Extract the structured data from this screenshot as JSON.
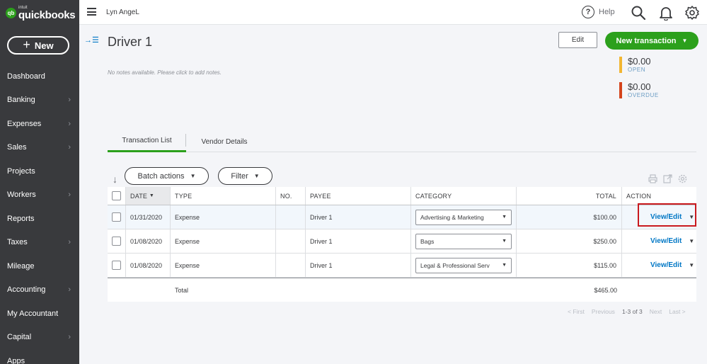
{
  "sidebar": {
    "logo_small": "intuit",
    "logo_name": "quickbooks",
    "logo_mark": "qb",
    "new_label": "New",
    "items": [
      {
        "label": "Dashboard",
        "chevron": false
      },
      {
        "label": "Banking",
        "chevron": true
      },
      {
        "label": "Expenses",
        "chevron": true
      },
      {
        "label": "Sales",
        "chevron": true
      },
      {
        "label": "Projects",
        "chevron": false
      },
      {
        "label": "Workers",
        "chevron": true
      },
      {
        "label": "Reports",
        "chevron": false
      },
      {
        "label": "Taxes",
        "chevron": true
      },
      {
        "label": "Mileage",
        "chevron": false
      },
      {
        "label": "Accounting",
        "chevron": true
      },
      {
        "label": "My Accountant",
        "chevron": false
      },
      {
        "label": "Capital",
        "chevron": true
      },
      {
        "label": "Apps",
        "chevron": false
      }
    ]
  },
  "topbar": {
    "company_name": "Lyn AngeL",
    "help_label": "Help",
    "icons": [
      "help-icon",
      "search-icon",
      "bell-icon",
      "gear-icon"
    ]
  },
  "vendor": {
    "name": "Driver 1",
    "notes_placeholder": "No notes available. Please click to add notes.",
    "edit_label": "Edit",
    "new_transaction_label": "New transaction",
    "open_amount": "$0.00",
    "open_label": "OPEN",
    "overdue_amount": "$0.00",
    "overdue_label": "OVERDUE",
    "open_color": "#f2b632",
    "overdue_color": "#d4441c"
  },
  "tabs": [
    {
      "label": "Transaction List",
      "active": true
    },
    {
      "label": "Vendor Details",
      "active": false
    }
  ],
  "toolbar": {
    "batch_actions_label": "Batch actions",
    "filter_label": "Filter"
  },
  "table": {
    "headers": {
      "date": "DATE",
      "type": "TYPE",
      "no": "NO.",
      "payee": "PAYEE",
      "category": "CATEGORY",
      "total": "TOTAL",
      "action": "ACTION"
    },
    "rows": [
      {
        "date": "01/31/2020",
        "type": "Expense",
        "no": "",
        "payee": "Driver 1",
        "category": "Advertising & Marketing",
        "total": "$100.00",
        "action": "View/Edit"
      },
      {
        "date": "01/08/2020",
        "type": "Expense",
        "no": "",
        "payee": "Driver 1",
        "category": "Bags",
        "total": "$250.00",
        "action": "View/Edit"
      },
      {
        "date": "01/08/2020",
        "type": "Expense",
        "no": "",
        "payee": "Driver 1",
        "category": "Legal & Professional Serv",
        "total": "$115.00",
        "action": "View/Edit"
      }
    ],
    "total_label": "Total",
    "total_value": "$465.00"
  },
  "pager": {
    "first": "< First",
    "previous": "Previous",
    "range": "1-3 of 3",
    "next": "Next",
    "last": "Last >"
  },
  "colors": {
    "brand_green": "#2ca01c",
    "link_blue": "#0077c5",
    "sidebar_bg": "#393a3d",
    "highlight_red": "#c9191e"
  }
}
